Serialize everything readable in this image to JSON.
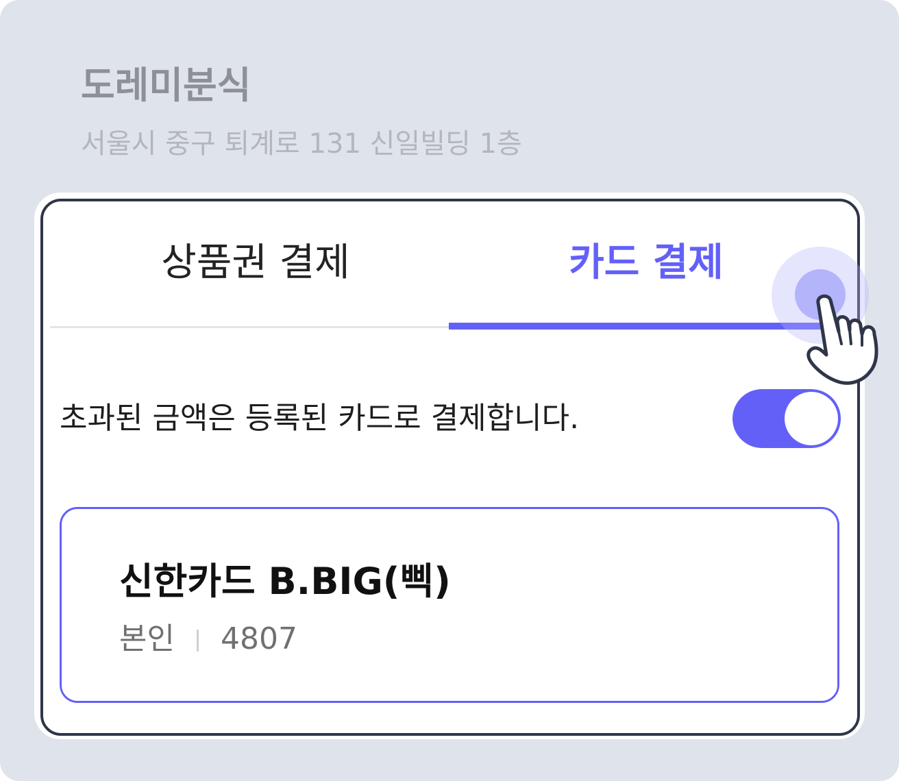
{
  "store": {
    "name": "도레미분식",
    "address": "서울시 중구 퇴계로 131 신일빌딩 1층"
  },
  "tabs": [
    {
      "label": "상품권 결제",
      "selected": false
    },
    {
      "label": "카드 결제",
      "selected": true
    }
  ],
  "overflow_payment": {
    "label": "초과된 금액은 등록된 카드로 결제합니다.",
    "enabled": true
  },
  "registered_card": {
    "name": "신한카드 B.BIG(삑)",
    "owner": "본인",
    "last_digits": "4807"
  },
  "colors": {
    "accent": "#6360f8",
    "background": "#dfe3eb",
    "card_border": "#2f3649"
  },
  "icons": {
    "cursor": "pointing-hand-icon"
  }
}
